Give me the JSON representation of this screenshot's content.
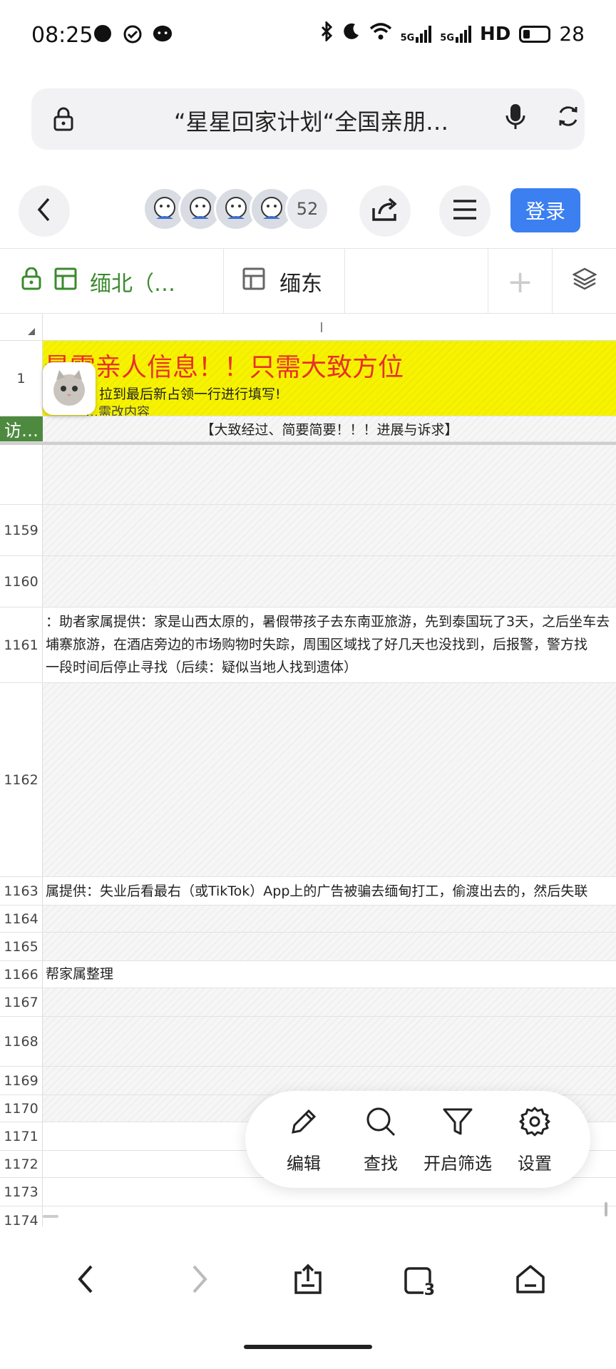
{
  "status_bar": {
    "time": "08:25",
    "signal_1": "5G",
    "signal_2": "5G",
    "hd": "HD",
    "battery": "28",
    "icons": [
      "chat-bubble-icon",
      "check-circle-icon",
      "message-icon",
      "bluetooth-icon",
      "moon-icon",
      "wifi-icon"
    ]
  },
  "address_bar": {
    "url_text": "“星星回家计划“全国亲朋…",
    "icons": [
      "lock-icon",
      "mic-icon",
      "refresh-icon"
    ]
  },
  "toolbar": {
    "participant_count": "52",
    "login_label": "登录",
    "accent": "#3b7ff0"
  },
  "sheet_tabs": {
    "tabs": [
      {
        "label": "缅北（…",
        "active": true
      },
      {
        "label": "缅东",
        "active": false
      }
    ],
    "active_color": "#3a8a2c",
    "add_symbol": "+"
  },
  "grid": {
    "banner": {
      "title": "最需亲人信息！！只需大致方位",
      "subtitle": "！拉到最后新占领一行进行填写!",
      "subtitle2": "…需改内容",
      "bg_color": "#f7f300",
      "title_color": "#e8302a"
    },
    "header_row": {
      "label": "访…",
      "text": "【大致经过、简要简要！！！进展与诉求】",
      "label_bg": "#4d8a3f"
    },
    "rows": [
      {
        "num": "",
        "lines": []
      },
      {
        "num": "1159",
        "lines": []
      },
      {
        "num": "1160",
        "lines": []
      },
      {
        "num": "1161",
        "lines": [
          "：助者家属提供：家是山西太原的，暑假带孩子去东南亚旅游，先到泰国玩了3天，之后坐车去",
          "埔寨旅游，在酒店旁边的市场购物时失踪，周围区域找了好几天也没找到，后报警，警方找",
          "一段时间后停止寻找（后续：疑似当地人找到遗体）"
        ]
      },
      {
        "num": "1162",
        "lines": []
      },
      {
        "num": "1163",
        "lines": [
          "属提供：失业后看最右（或TikTok）App上的广告被骗去缅甸打工，偷渡出去的，然后失联"
        ]
      },
      {
        "num": "1164",
        "lines": []
      },
      {
        "num": "1165",
        "lines": []
      },
      {
        "num": "1166",
        "lines": [
          "帮家属整理"
        ]
      },
      {
        "num": "1167",
        "lines": []
      },
      {
        "num": "1168",
        "lines": []
      },
      {
        "num": "1169",
        "lines": []
      },
      {
        "num": "1170",
        "lines": []
      },
      {
        "num": "1171",
        "lines": []
      },
      {
        "num": "1172",
        "lines": []
      },
      {
        "num": "1173",
        "lines": []
      },
      {
        "num": "1174",
        "lines": []
      }
    ],
    "first_row_num": "1"
  },
  "fab": {
    "edit_label": "编辑",
    "search_label": "查找",
    "filter_label": "开启筛选",
    "settings_label": "设置"
  },
  "bottom_nav": {
    "tab_count": "3"
  }
}
